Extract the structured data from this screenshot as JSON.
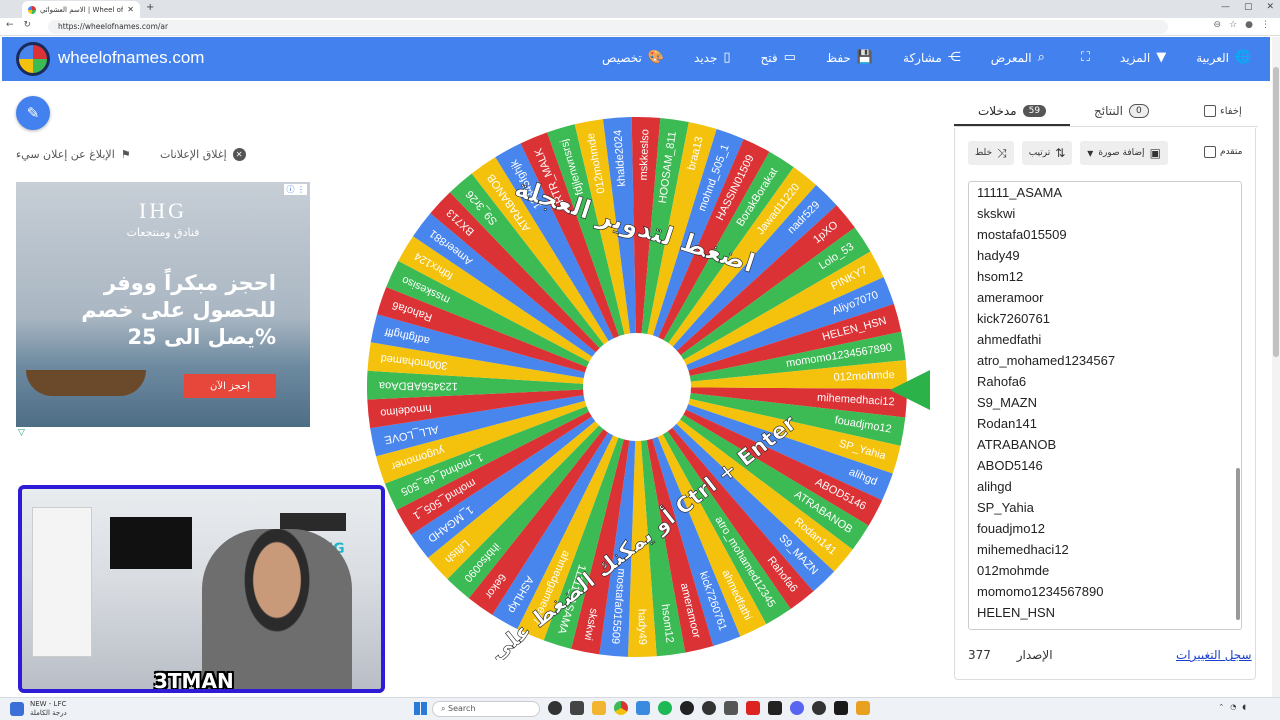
{
  "browser": {
    "tab_title": "الاسم العشوائي | Wheel of Names",
    "url": "https://wheelofnames.com/ar"
  },
  "header": {
    "site": "wheelofnames.com",
    "menu": [
      {
        "label": "تخصيص",
        "icon": "palette-icon",
        "glyph": "🎨"
      },
      {
        "label": "جديد",
        "icon": "file-icon",
        "glyph": "▯"
      },
      {
        "label": "فتح",
        "icon": "folder-icon",
        "glyph": "▭"
      },
      {
        "label": "حفظ",
        "icon": "save-icon",
        "glyph": "💾"
      },
      {
        "label": "مشاركة",
        "icon": "share-icon",
        "glyph": "⋲"
      },
      {
        "label": "المعرض",
        "icon": "search-icon",
        "glyph": "⌕"
      },
      {
        "label": "",
        "icon": "fullscreen-icon",
        "glyph": "⛶"
      },
      {
        "label": "المزيد",
        "icon": "chevron-down-icon",
        "glyph": "▼"
      },
      {
        "label": "العربية",
        "icon": "globe-icon",
        "glyph": "🌐"
      }
    ]
  },
  "left": {
    "report_label": "الإبلاغ عن إعلان سيء",
    "close_ads_label": "إغلاق الإعلانات"
  },
  "ad": {
    "brand": "IHG",
    "sub": "فنادق ومنتجعات",
    "headline": "احجز مبكراً ووفر للحصول على خصم يصل الى 25%",
    "cta": "إحجز الآن"
  },
  "cam": {
    "sign": "GAMING",
    "tag": "3TMAN"
  },
  "wheel": {
    "center_text_top": "اضغط لتدوير العجلة",
    "center_text_bottom": "أو يمكنك الضغط على زر Ctrl + Enter",
    "colors": [
      "#db3236",
      "#3cba54",
      "#f4c20d",
      "#4885ed"
    ],
    "labels": [
      "mihemedhaci12",
      "fouadjmo12",
      "SP_Yahia",
      "alihgd",
      "ABOD5146",
      "ATRABANOB",
      "Rodan141",
      "S9_MAZN",
      "Rahofa6",
      "atro_mohamed12345",
      "ahmedfathi",
      "kick7260761",
      "ameramoor",
      "hsom12",
      "hady49",
      "mostafa015509",
      "skskwi",
      "11111_ASAMA",
      "ahmedgamee47",
      "ASHLkp",
      "6ekor",
      "ihbfso090",
      "Liftish",
      "1_MGAHD",
      "mohnd_505_1",
      "1_mohnd_de_505",
      "yugomoner",
      "ALL_LOVE",
      "hmodelmo",
      "123456ABDAoa",
      "300mohamed",
      "adfgthgfff",
      "Rahofa6",
      "msskesiso",
      "fdhrx124",
      "Ameer881",
      "BX713",
      "S9_3r26",
      "ATRABANOB",
      "12345fghjk",
      "RTR_MALK",
      "fdjlenwnsrsj",
      "012mohmde",
      "khalde2024",
      "mskkeslso",
      "HOOSAM_811",
      "braa13",
      "mohnd_505_1",
      "HASSIN01509",
      "BorakBorakat",
      "Jawad11220",
      "nadr529",
      "1pXO",
      "Lolo_53",
      "PINKY7",
      "Aliyo7070",
      "HELEN_HSN",
      "momomo1234567890",
      "012mohmde"
    ]
  },
  "tabs": {
    "entries_label": "مدخلات",
    "entries_count": "59",
    "results_label": "النتائج",
    "results_count": "0",
    "hide_label": "إخفاء"
  },
  "toolbar": {
    "shuffle_label": "خلط",
    "sort_label": "ترتيب",
    "add_image_label": "إضافة صورة",
    "advanced_label": "متقدم"
  },
  "entries_list": [
    "11111_ASAMA",
    "skskwi",
    "mostafa015509",
    "hady49",
    "hsom12",
    "ameramoor",
    "kick7260761",
    "ahmedfathi",
    "atro_mohamed1234567",
    "Rahofa6",
    "S9_MAZN",
    "Rodan141",
    "ATRABANOB",
    "ABOD5146",
    "alihgd",
    "SP_Yahia",
    "fouadjmo12",
    "mihemedhaci12",
    "012mohmde",
    "momomo1234567890",
    "HELEN_HSN"
  ],
  "footer": {
    "version_label": "الإصدار",
    "version_num": "377",
    "changelog": "سجل التغييرات"
  },
  "taskbar": {
    "news_title": "NEW - LFC",
    "news_sub": "درجة الكاملة",
    "search_placeholder": "Search"
  }
}
